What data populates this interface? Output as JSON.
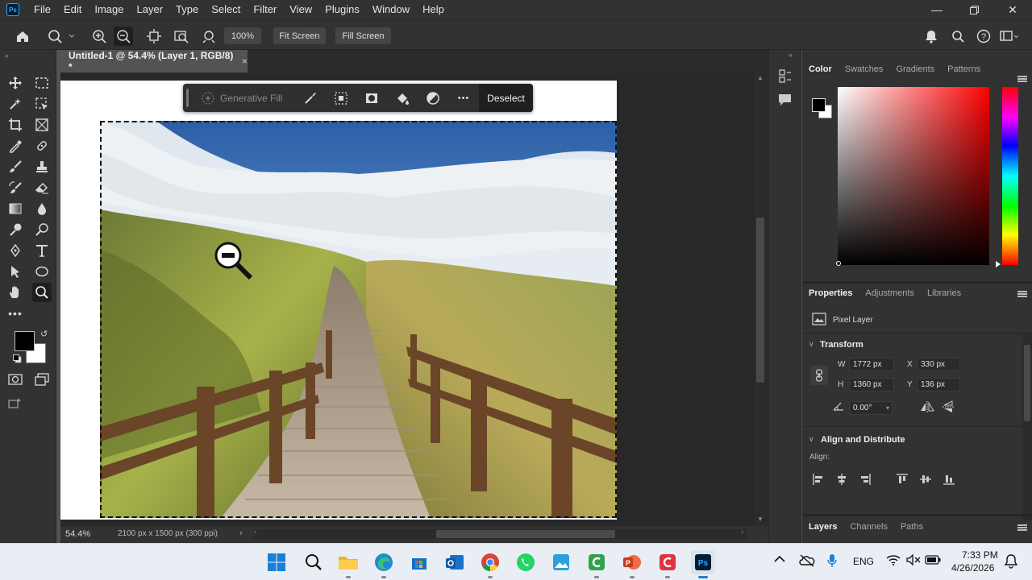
{
  "menubar": {
    "app_icon": "Ps",
    "items": [
      "File",
      "Edit",
      "Image",
      "Layer",
      "Type",
      "Select",
      "Filter",
      "View",
      "Plugins",
      "Window",
      "Help"
    ]
  },
  "options": {
    "zoom_value": "100%",
    "fit_screen": "Fit Screen",
    "fill_screen": "Fill Screen"
  },
  "document": {
    "tab_title": "Untitled-1 @ 54.4% (Layer 1, RGB/8) *",
    "close": "×"
  },
  "contextbar": {
    "generative_fill": "Generative Fill",
    "deselect": "Deselect",
    "more": "•••"
  },
  "status": {
    "zoom": "54.4%",
    "doc_info": "2100 px x 1500 px (300 ppi)"
  },
  "color_panel": {
    "tabs": [
      "Color",
      "Swatches",
      "Gradients",
      "Patterns"
    ],
    "hue_color": "#ff0000"
  },
  "properties_panel": {
    "tabs": [
      "Properties",
      "Adjustments",
      "Libraries"
    ],
    "layer_type": "Pixel Layer",
    "transform_title": "Transform",
    "w_label": "W",
    "w_value": "1772 px",
    "h_label": "H",
    "h_value": "1360 px",
    "x_label": "X",
    "x_value": "330 px",
    "y_label": "Y",
    "y_value": "136 px",
    "angle_value": "0.00°",
    "align_title": "Align and Distribute",
    "align_label": "Align:"
  },
  "layers_panel": {
    "tabs": [
      "Layers",
      "Channels",
      "Paths"
    ]
  },
  "taskbar": {
    "lang": "ENG",
    "time": "7:33 PM",
    "date": "4/26/2026"
  }
}
